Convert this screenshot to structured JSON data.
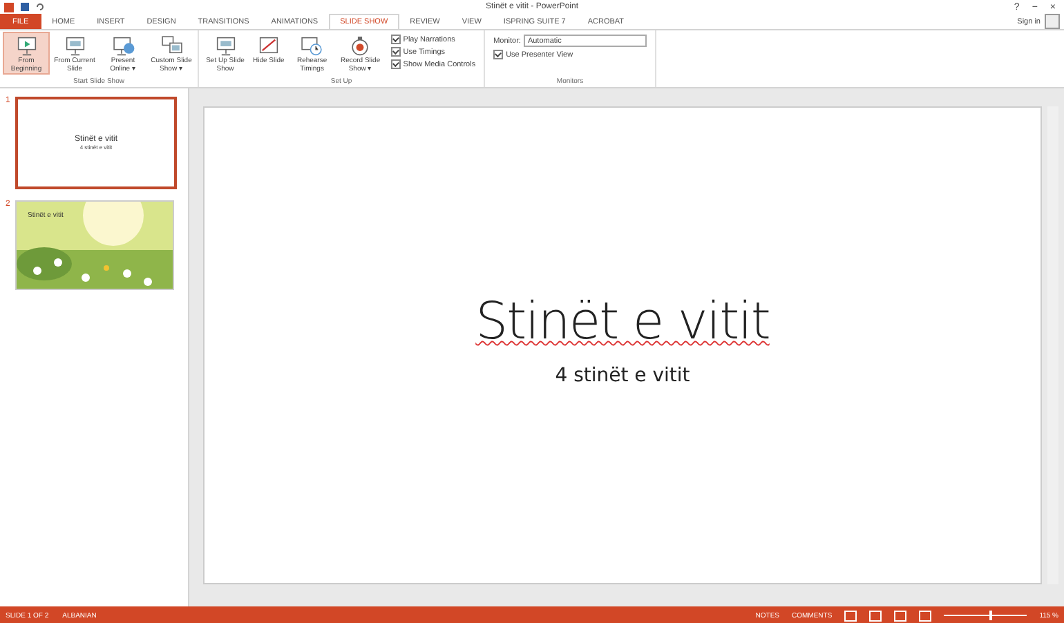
{
  "window": {
    "title": "Stinët e vitit - PowerPoint",
    "controls": [
      "?",
      "−",
      "×"
    ],
    "sign_in": "Sign in"
  },
  "tabs": [
    {
      "label": "FILE",
      "kind": "file",
      "selected": false
    },
    {
      "label": "HOME",
      "kind": "tab",
      "selected": false
    },
    {
      "label": "INSERT",
      "kind": "tab",
      "selected": false
    },
    {
      "label": "DESIGN",
      "kind": "tab",
      "selected": false
    },
    {
      "label": "TRANSITIONS",
      "kind": "tab",
      "selected": false
    },
    {
      "label": "ANIMATIONS",
      "kind": "tab",
      "selected": false
    },
    {
      "label": "SLIDE SHOW",
      "kind": "tab",
      "selected": true
    },
    {
      "label": "REVIEW",
      "kind": "tab",
      "selected": false
    },
    {
      "label": "VIEW",
      "kind": "tab",
      "selected": false
    },
    {
      "label": "ISPRING SUITE 7",
      "kind": "tab",
      "selected": false
    },
    {
      "label": "ACROBAT",
      "kind": "tab",
      "selected": false
    }
  ],
  "ribbon_groups": [
    {
      "label": "Start Slide Show",
      "buttons": [
        {
          "label": "From Beginning",
          "kind": "play",
          "selected": true
        },
        {
          "label": "From Current Slide",
          "kind": "screen",
          "selected": false
        },
        {
          "label": "Present Online ▾",
          "kind": "globe",
          "selected": false
        },
        {
          "label": "Custom Slide Show ▾",
          "kind": "screens",
          "selected": false
        }
      ]
    },
    {
      "label": "Set Up",
      "buttons": [
        {
          "label": "Set Up Slide Show",
          "kind": "screen",
          "selected": false
        },
        {
          "label": "Hide Slide",
          "kind": "hide",
          "selected": false
        },
        {
          "label": "Rehearse Timings",
          "kind": "clock",
          "selected": false
        },
        {
          "label": "Record Slide Show ▾",
          "kind": "record",
          "selected": false
        }
      ],
      "checks": [
        {
          "label": "Play Narrations",
          "checked": true
        },
        {
          "label": "Use Timings",
          "checked": true
        },
        {
          "label": "Show Media Controls",
          "checked": true
        }
      ]
    },
    {
      "label": "Monitors",
      "monitor": {
        "label": "Monitor:",
        "value": "Automatic"
      },
      "checks": [
        {
          "label": "Use Presenter View",
          "checked": true
        }
      ]
    }
  ],
  "slides": [
    {
      "number": "1",
      "selected": true,
      "kind": "title",
      "title": "Stinët e vitit",
      "subtitle": "4 stinët e vitit"
    },
    {
      "number": "2",
      "selected": false,
      "kind": "picture",
      "title": "Stinët e vitit"
    }
  ],
  "slide": {
    "title": "Stinët e vitit",
    "subtitle": "4 stinët e vitit"
  },
  "status_bar": {
    "slide": "SLIDE 1 OF 2",
    "language": "ALBANIAN",
    "notes": "NOTES",
    "comments": "COMMENTS",
    "zoom_slider": {
      "level": 0.55
    },
    "zoom": "115 %"
  }
}
